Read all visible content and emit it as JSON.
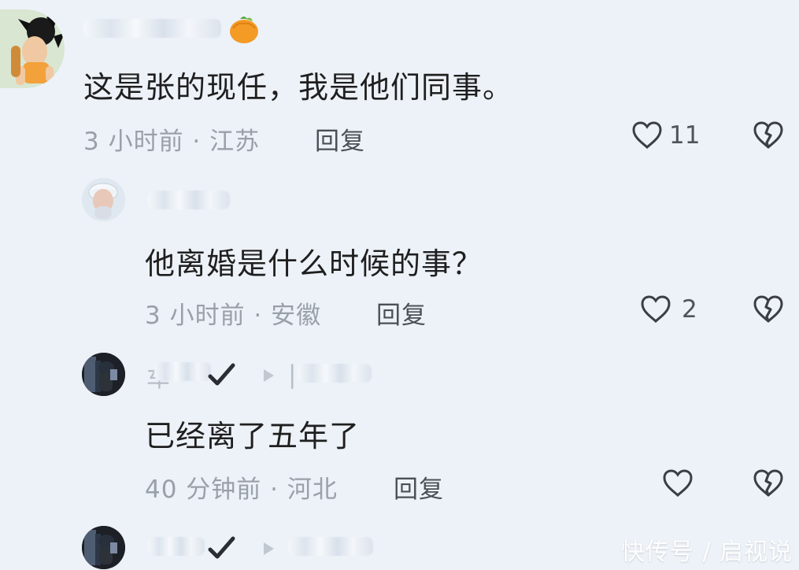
{
  "comments": [
    {
      "text": "这是张的现任，我是他们同事。",
      "meta": "3 小时前 · 江苏",
      "reply": "回复",
      "likes": "11"
    },
    {
      "text": "他离婚是什么时候的事？",
      "meta": "3 小时前 · 安徽",
      "reply": "回复",
      "likes": "2"
    },
    {
      "text": "已经离了五年了",
      "meta": "40 分钟前 · 河北",
      "reply": "回复",
      "likes": ""
    }
  ],
  "watermark": "快传号 / 启视说",
  "icons": {
    "heart": "heart-outline-icon",
    "dislike": "broken-heart-icon",
    "play": "play-triangle-icon",
    "verified": "checkmark-icon",
    "badge": "tangerine-icon"
  }
}
